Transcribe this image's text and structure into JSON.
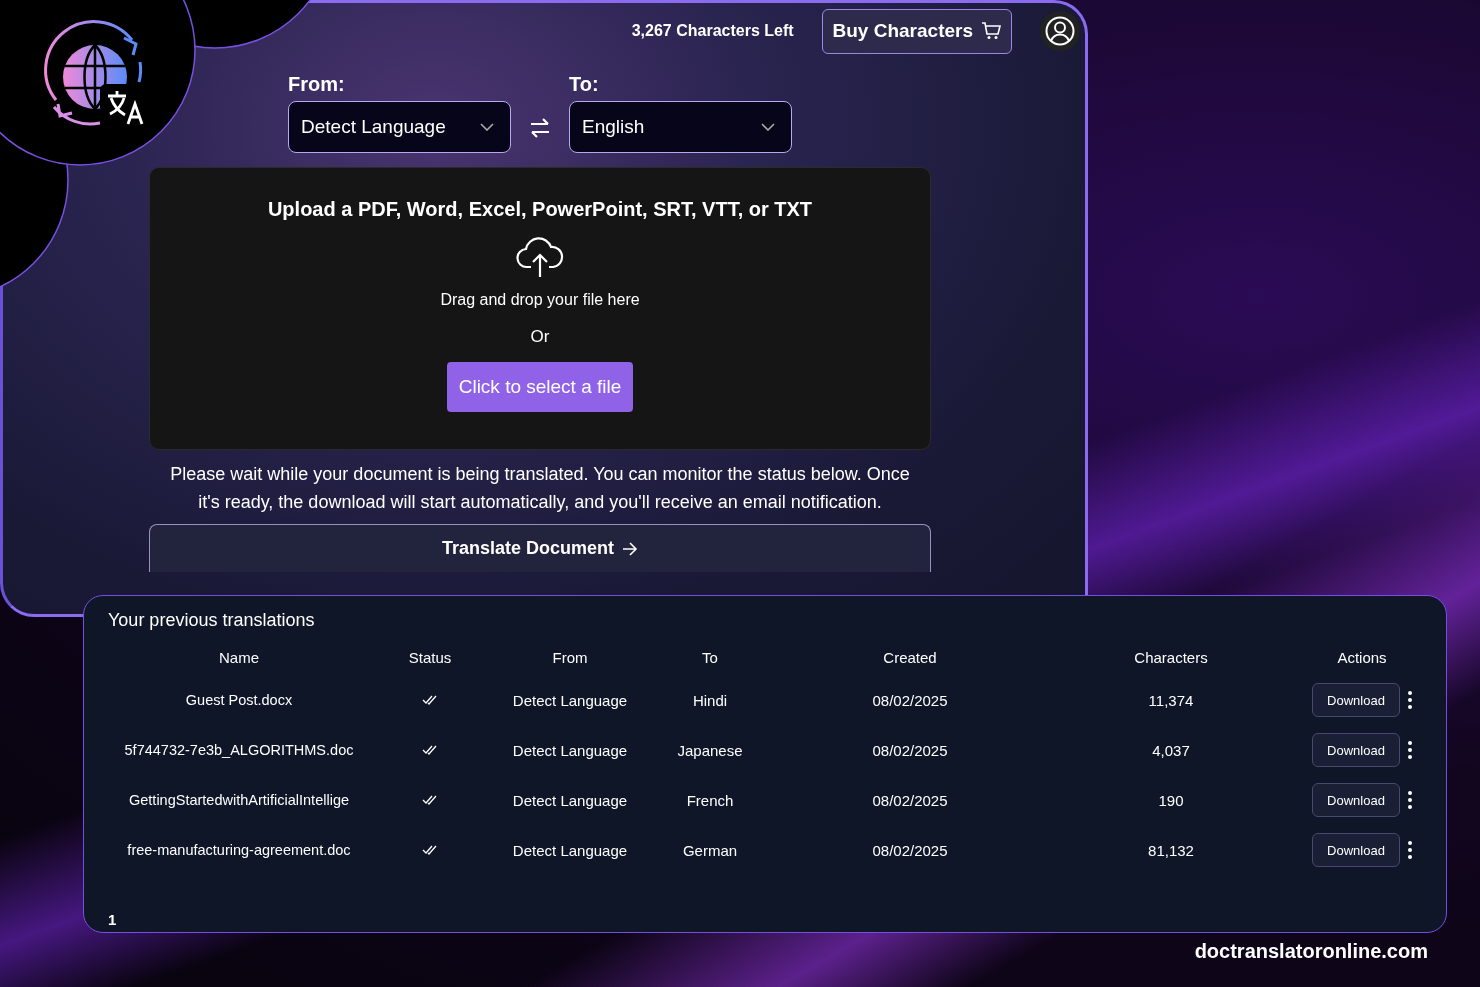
{
  "header": {
    "credits": "3,267 Characters Left",
    "buy_button": "Buy Characters"
  },
  "language": {
    "from_label": "From:",
    "from_value": "Detect Language",
    "to_label": "To:",
    "to_value": "English"
  },
  "upload": {
    "title": "Upload a PDF, Word, Excel, PowerPoint, SRT, VTT, or TXT",
    "hint": "Drag and drop your file here",
    "or": "Or",
    "select_button": "Click to select a file"
  },
  "notice": "Please wait while your document is being translated. You can monitor the status below. Once it's ready, the download will start automatically, and you'll receive an email notification.",
  "translate_button": "Translate Document",
  "table": {
    "title": "Your previous translations",
    "columns": [
      "Name",
      "Status",
      "From",
      "To",
      "Created",
      "Characters",
      "Actions"
    ],
    "rows": [
      {
        "name": "Guest Post.docx",
        "kind": "done",
        "from": "Detect Language",
        "to": "Hindi",
        "created": "08/02/2025",
        "characters": "11,374",
        "action": "Download"
      },
      {
        "name": "5f744732-7e3b_ALGORITHMS.doc",
        "kind": "done",
        "from": "Detect Language",
        "to": "Japanese",
        "created": "08/02/2025",
        "characters": "4,037",
        "action": "Download"
      },
      {
        "name": "GettingStartedwithArtificialIntellige",
        "kind": "done",
        "from": "Detect Language",
        "to": "French",
        "created": "08/02/2025",
        "characters": "190",
        "action": "Download"
      },
      {
        "name": "free-manufacturing-agreement.doc",
        "kind": "done",
        "from": "Detect Language",
        "to": "German",
        "created": "08/02/2025",
        "characters": "81,132",
        "action": "Download"
      }
    ],
    "pages": [
      {
        "label": "1",
        "selected": true
      }
    ]
  },
  "footer": {
    "site": "doctranslatoronline.com"
  }
}
